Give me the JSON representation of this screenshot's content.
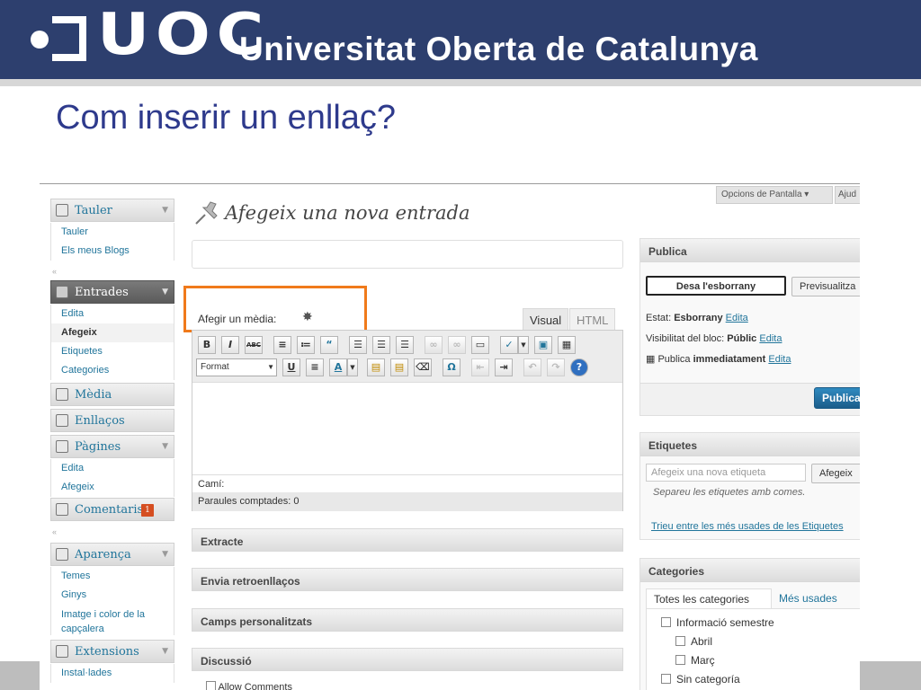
{
  "header": {
    "logo_text": "UOC",
    "university_name": "Universitat Oberta de Catalunya"
  },
  "slide_title": "Com inserir un enllaç?",
  "top_buttons": {
    "screen_options": "Opcions de Pantalla ▾",
    "help": "Ajud"
  },
  "sidebar": {
    "tauler": {
      "label": "Tauler",
      "items": [
        "Tauler",
        "Els meus Blogs"
      ]
    },
    "entrades": {
      "label": "Entrades",
      "items": [
        "Edita",
        "Afegeix",
        "Etiquetes",
        "Categories"
      ]
    },
    "media": {
      "label": "Mèdia"
    },
    "enllacos": {
      "label": "Enllaços"
    },
    "pagines": {
      "label": "Pàgines",
      "items": [
        "Edita",
        "Afegeix"
      ]
    },
    "comentaris": {
      "label": "Comentaris",
      "badge": "1"
    },
    "aparenca": {
      "label": "Aparença",
      "items": [
        "Temes",
        "Ginys",
        "Imatge i color de la capçalera"
      ]
    },
    "extensions": {
      "label": "Extensions",
      "items": [
        "Instal·lades"
      ]
    }
  },
  "page_heading": "Afegeix una nova entrada",
  "editor": {
    "add_media_label": "Afegir un mèdia:",
    "tabs": [
      "Visual",
      "HTML"
    ],
    "format_select": "Format",
    "path_label": "Camí:",
    "word_count": "Paraules comptades: 0"
  },
  "meta_boxes": [
    "Extracte",
    "Envia retroenllaços",
    "Camps personalitzats",
    "Discussió"
  ],
  "discussion": {
    "allow_comments": "Allow Comments"
  },
  "publish": {
    "title": "Publica",
    "save_draft": "Desa l'esborrany",
    "preview": "Previsualitza",
    "status_label": "Estat:",
    "status_value": "Esborrany",
    "visibility_label": "Visibilitat del bloc:",
    "visibility_value": "Públic",
    "schedule_label": "Publica",
    "schedule_value": "immediatament",
    "edit_link": "Edita",
    "publish_button": "Publica"
  },
  "tags": {
    "title": "Etiquetes",
    "placeholder": "Afegeix una nova etiqueta",
    "add_button": "Afegeix",
    "hint": "Separeu les etiquetes amb comes.",
    "choose_link": "Trieu entre les més usades de les Etiquetes"
  },
  "categories": {
    "title": "Categories",
    "tabs": [
      "Totes les categories",
      "Més usades"
    ],
    "items": [
      "Informació semestre",
      "Abril",
      "Març",
      "Sin categoría"
    ]
  },
  "colors": {
    "header_bg": "#2d3f6e",
    "title_color": "#2e3a8c",
    "highlight_box": "#f07a1b",
    "link": "#21759b"
  }
}
